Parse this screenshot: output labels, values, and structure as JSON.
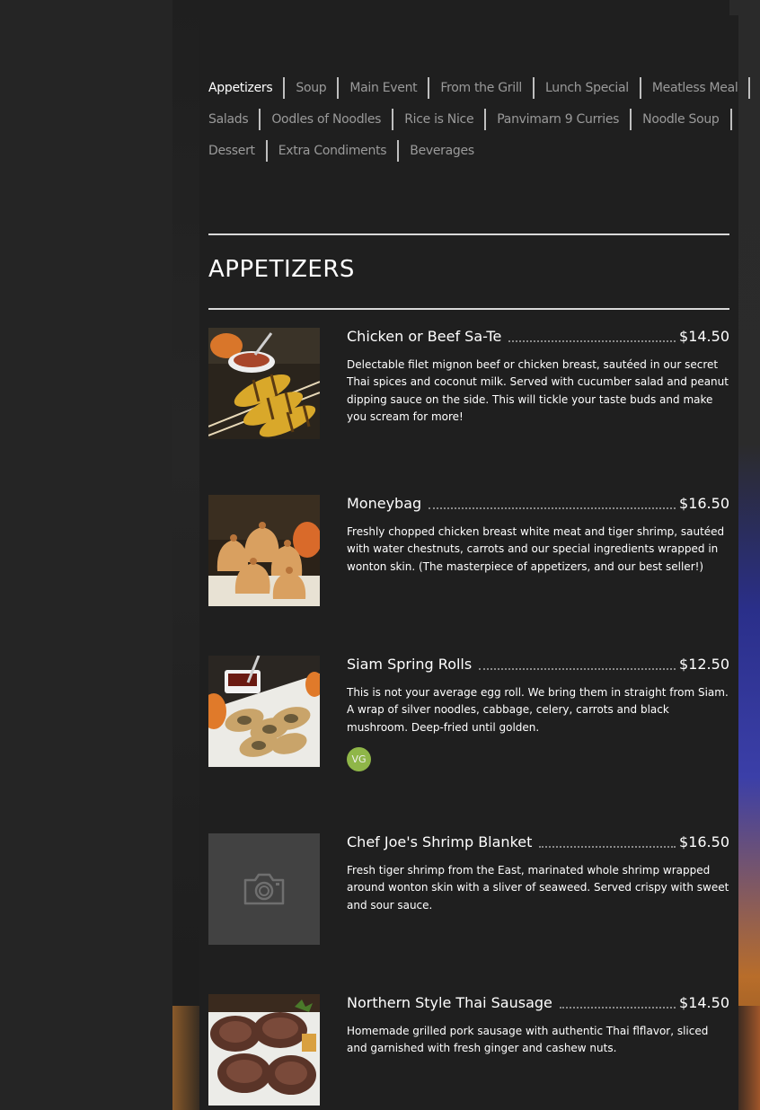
{
  "nav": {
    "tabs": [
      [
        "Appetizers",
        "Soup",
        "Main Event",
        "From the Grill",
        "Lunch Special",
        "Meatless Meal"
      ],
      [
        "Salads",
        "Oodles of Noodles",
        "Rice is Nice",
        "Panvimarn 9 Curries",
        "Noodle Soup"
      ],
      [
        "Dessert",
        "Extra Condiments",
        "Beverages"
      ]
    ],
    "active": "Appetizers"
  },
  "section": {
    "title": "APPETIZERS"
  },
  "items": [
    {
      "name": "Chicken or Beef Sa-Te",
      "price": "$14.50",
      "description": "Delectable filet mignon beef or chicken breast, sautéed in our secret Thai spices and coconut milk. Served with cucumber salad and peanut dipping sauce on the side. This will tickle your taste buds and make you scream for more!",
      "photo": "satay-skewers"
    },
    {
      "name": "Moneybag",
      "price": "$16.50",
      "description": "Freshly chopped chicken breast white meat and tiger shrimp, sautéed with water chestnuts, carrots and our special ingredients wrapped in wonton skin. (The masterpiece of appetizers, and our best seller!)",
      "photo": "moneybag-dumplings"
    },
    {
      "name": "Siam Spring Rolls",
      "price": "$12.50",
      "description": "This is not your average egg roll. We bring them in straight from Siam. A wrap of silver noodles, cabbage, celery, carrots and black mushroom. Deep-fried until golden.",
      "badge": "VG",
      "photo": "spring-rolls"
    },
    {
      "name": "Chef Joe's Shrimp Blanket",
      "price": "$16.50",
      "description": "Fresh tiger shrimp from the East, marinated whole shrimp wrapped around wonton skin with a sliver of seaweed. Served crispy with sweet and sour sauce.",
      "photo": "camera-placeholder-icon"
    },
    {
      "name": "Northern Style Thai Sausage",
      "price": "$14.50",
      "description": "Homemade grilled pork sausage with authentic Thai flflavor, sliced and garnished with fresh ginger and cashew nuts.",
      "photo": "sliced-sausage"
    }
  ]
}
